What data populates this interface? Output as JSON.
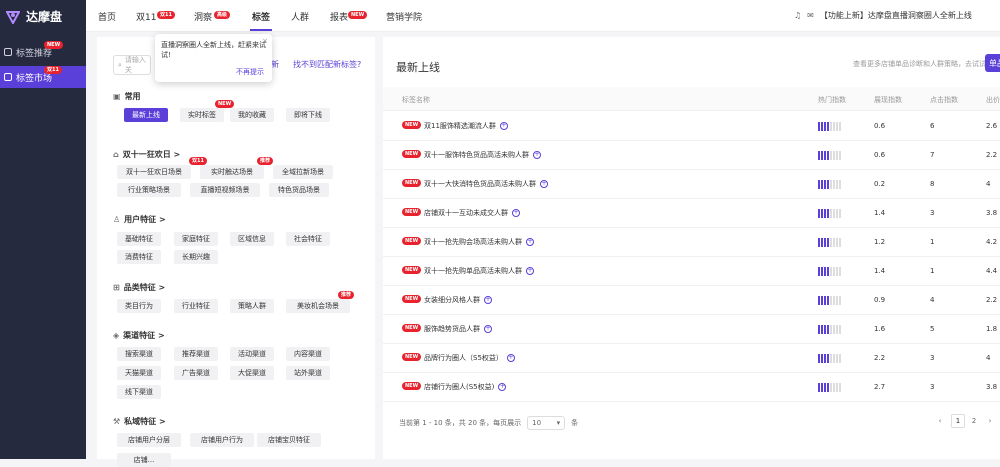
{
  "brand": {
    "name": "达摩盘",
    "color": "#5a3fd9"
  },
  "sidebar": {
    "items": [
      {
        "label": "标签推荐",
        "badge": "NEW"
      },
      {
        "label": "标签市场",
        "badge": "双11",
        "active": true
      }
    ]
  },
  "topnav": {
    "items": [
      {
        "label": "首页"
      },
      {
        "label": "双11",
        "badge": "双11"
      },
      {
        "label": "洞察",
        "badge": "高级"
      },
      {
        "label": "标签",
        "active": true
      },
      {
        "label": "人群"
      },
      {
        "label": "报表",
        "badge": "NEW"
      },
      {
        "label": "营销学院"
      }
    ]
  },
  "notice": {
    "text": "【功能上新】达摩盘直播洞察圈人全新上线"
  },
  "left": {
    "search_placeholder": "请输入关",
    "link1": "新",
    "link2": "找不到匹配新标签?",
    "tooltip": {
      "text": "直播洞察圈人全新上线，赶紧来试试!",
      "dismiss": "不再提示",
      "close": "×"
    },
    "sections": [
      {
        "title": "常用",
        "icon": "bookmark-icon",
        "tags": [
          {
            "label": "最新上线",
            "active": true
          },
          {
            "label": "实时标签",
            "badge": "NEW"
          },
          {
            "label": "我的收藏"
          },
          {
            "label": "即将下线"
          }
        ]
      },
      {
        "title": "双十一狂欢日 >",
        "icon": "shop-icon",
        "tags": [
          {
            "label": "双十一狂欢日场景",
            "badge": "双11"
          },
          {
            "label": "实时触达场景",
            "badge": "推荐"
          },
          {
            "label": "全域拉新场景"
          },
          {
            "label": "行业策略场景"
          },
          {
            "label": "直播短视频场景"
          },
          {
            "label": "特色货品场景"
          }
        ]
      },
      {
        "title": "用户特征 >",
        "icon": "shirt-icon",
        "tags": [
          {
            "label": "基础特征"
          },
          {
            "label": "家庭特征"
          },
          {
            "label": "区域信息"
          },
          {
            "label": "社会特征"
          },
          {
            "label": "消费特征"
          },
          {
            "label": "长期兴趣"
          }
        ]
      },
      {
        "title": "品类特征 >",
        "icon": "grid-icon",
        "tags": [
          {
            "label": "类目行为"
          },
          {
            "label": "行业特征"
          },
          {
            "label": "策略人群"
          },
          {
            "label": "美妆机会场景",
            "badge": "推荐"
          }
        ]
      },
      {
        "title": "渠道特征 >",
        "icon": "layers-icon",
        "tags": [
          {
            "label": "搜索渠道"
          },
          {
            "label": "推荐渠道"
          },
          {
            "label": "活动渠道"
          },
          {
            "label": "内容渠道"
          },
          {
            "label": "天猫渠道"
          },
          {
            "label": "广告渠道"
          },
          {
            "label": "大促渠道"
          },
          {
            "label": "站外渠道"
          },
          {
            "label": "线下渠道"
          }
        ]
      },
      {
        "title": "私域特征 >",
        "icon": "tool-icon",
        "tags": [
          {
            "label": "店铺用户分层"
          },
          {
            "label": "店铺用户行为"
          },
          {
            "label": "店铺宝贝特征"
          },
          {
            "label": "店铺..."
          }
        ]
      }
    ]
  },
  "main": {
    "title": "最新上线",
    "hint": "查看更多店铺单品诊断和人群策略，去试试",
    "button": "单品",
    "headers": [
      "标签名称",
      "热门指数",
      "展现指数",
      "点击指数",
      "出价"
    ],
    "rows": [
      {
        "name": "双11服饰精选潮流人群",
        "heat": 4,
        "show": "0.6",
        "click": "6",
        "bid": "2.6"
      },
      {
        "name": "双十一服饰特色货品高活未购人群",
        "heat": 4,
        "show": "0.6",
        "click": "7",
        "bid": "2.2"
      },
      {
        "name": "双十一大快消特色货品高活未购人群",
        "heat": 4,
        "show": "0.2",
        "click": "8",
        "bid": "4"
      },
      {
        "name": "店铺双十一互动未成交人群",
        "heat": 4,
        "show": "1.4",
        "click": "3",
        "bid": "3.8"
      },
      {
        "name": "双十一抢先购会场高活未购人群",
        "heat": 4,
        "show": "1.2",
        "click": "1",
        "bid": "4.2"
      },
      {
        "name": "双十一抢先购单品高活未购人群",
        "heat": 4,
        "show": "1.4",
        "click": "1",
        "bid": "4.4"
      },
      {
        "name": "女装细分风格人群",
        "heat": 4,
        "show": "0.9",
        "click": "4",
        "bid": "2.2"
      },
      {
        "name": "服饰趋势货品人群",
        "heat": 4,
        "show": "1.6",
        "click": "5",
        "bid": "1.8"
      },
      {
        "name": "品牌行为圈人（S5权益）",
        "heat": 4,
        "show": "2.2",
        "click": "3",
        "bid": "4"
      },
      {
        "name": "店铺行为圈人(S5权益)",
        "heat": 4,
        "show": "2.7",
        "click": "3",
        "bid": "3.8"
      }
    ],
    "footer": {
      "summary": "当前第 1 - 10 条，共 20 条，每页展示",
      "page_size": "10",
      "unit": "条",
      "prev": "‹",
      "pages": [
        "1",
        "2"
      ],
      "next": "›"
    }
  }
}
